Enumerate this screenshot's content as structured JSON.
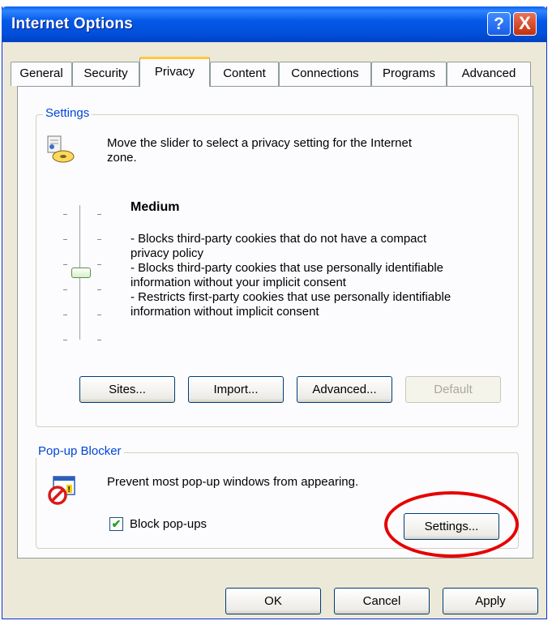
{
  "window": {
    "title": "Internet Options"
  },
  "titlebar_buttons": {
    "help": "?",
    "close": "X"
  },
  "tabs": [
    {
      "label": "General"
    },
    {
      "label": "Security"
    },
    {
      "label": "Privacy",
      "active": true
    },
    {
      "label": "Content"
    },
    {
      "label": "Connections"
    },
    {
      "label": "Programs"
    },
    {
      "label": "Advanced"
    }
  ],
  "settings": {
    "group_label": "Settings",
    "description_line1": "Move the slider to select a privacy setting for the Internet",
    "description_line2": "zone.",
    "level": "Medium",
    "slider_level": 0.5,
    "details": [
      "- Blocks third-party cookies that do not have a compact",
      "privacy policy",
      "- Blocks third-party cookies that use personally identifiable",
      "information without your implicit consent",
      "- Restricts first-party cookies that use personally identifiable",
      "information without implicit consent"
    ],
    "buttons": {
      "sites": "Sites...",
      "import": "Import...",
      "advanced": "Advanced...",
      "default": "Default"
    }
  },
  "popup": {
    "group_label": "Pop-up Blocker",
    "description": "Prevent most pop-up windows from appearing.",
    "checkbox_label": "Block pop-ups",
    "checkbox_checked": true,
    "settings_button": "Settings..."
  },
  "footer": {
    "ok": "OK",
    "cancel": "Cancel",
    "apply": "Apply"
  },
  "colors": {
    "titlebar": "#0558e8",
    "dialog_bg": "#ece9d8",
    "annotation": "#e60000",
    "group_label": "#0046d5"
  }
}
